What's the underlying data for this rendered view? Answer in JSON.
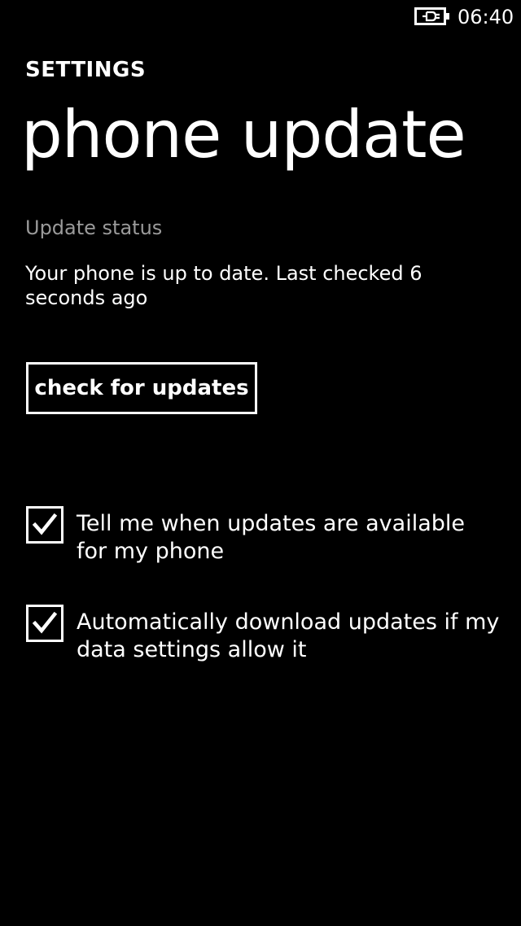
{
  "status_bar": {
    "battery_icon": "battery-charging-icon",
    "time": "06:40"
  },
  "header": {
    "app_title": "SETTINGS",
    "page_title": "phone update"
  },
  "update_status": {
    "label": "Update status",
    "message": "Your phone is up to date. Last checked 6 seconds ago"
  },
  "actions": {
    "check_button_label": "check for updates"
  },
  "options": [
    {
      "label": "Tell me when updates are available for my phone",
      "checked": true
    },
    {
      "label": "Automatically download updates if my data settings allow it",
      "checked": true
    }
  ],
  "colors": {
    "background": "#000000",
    "foreground": "#ffffff",
    "subtle": "#9a9a9a"
  }
}
